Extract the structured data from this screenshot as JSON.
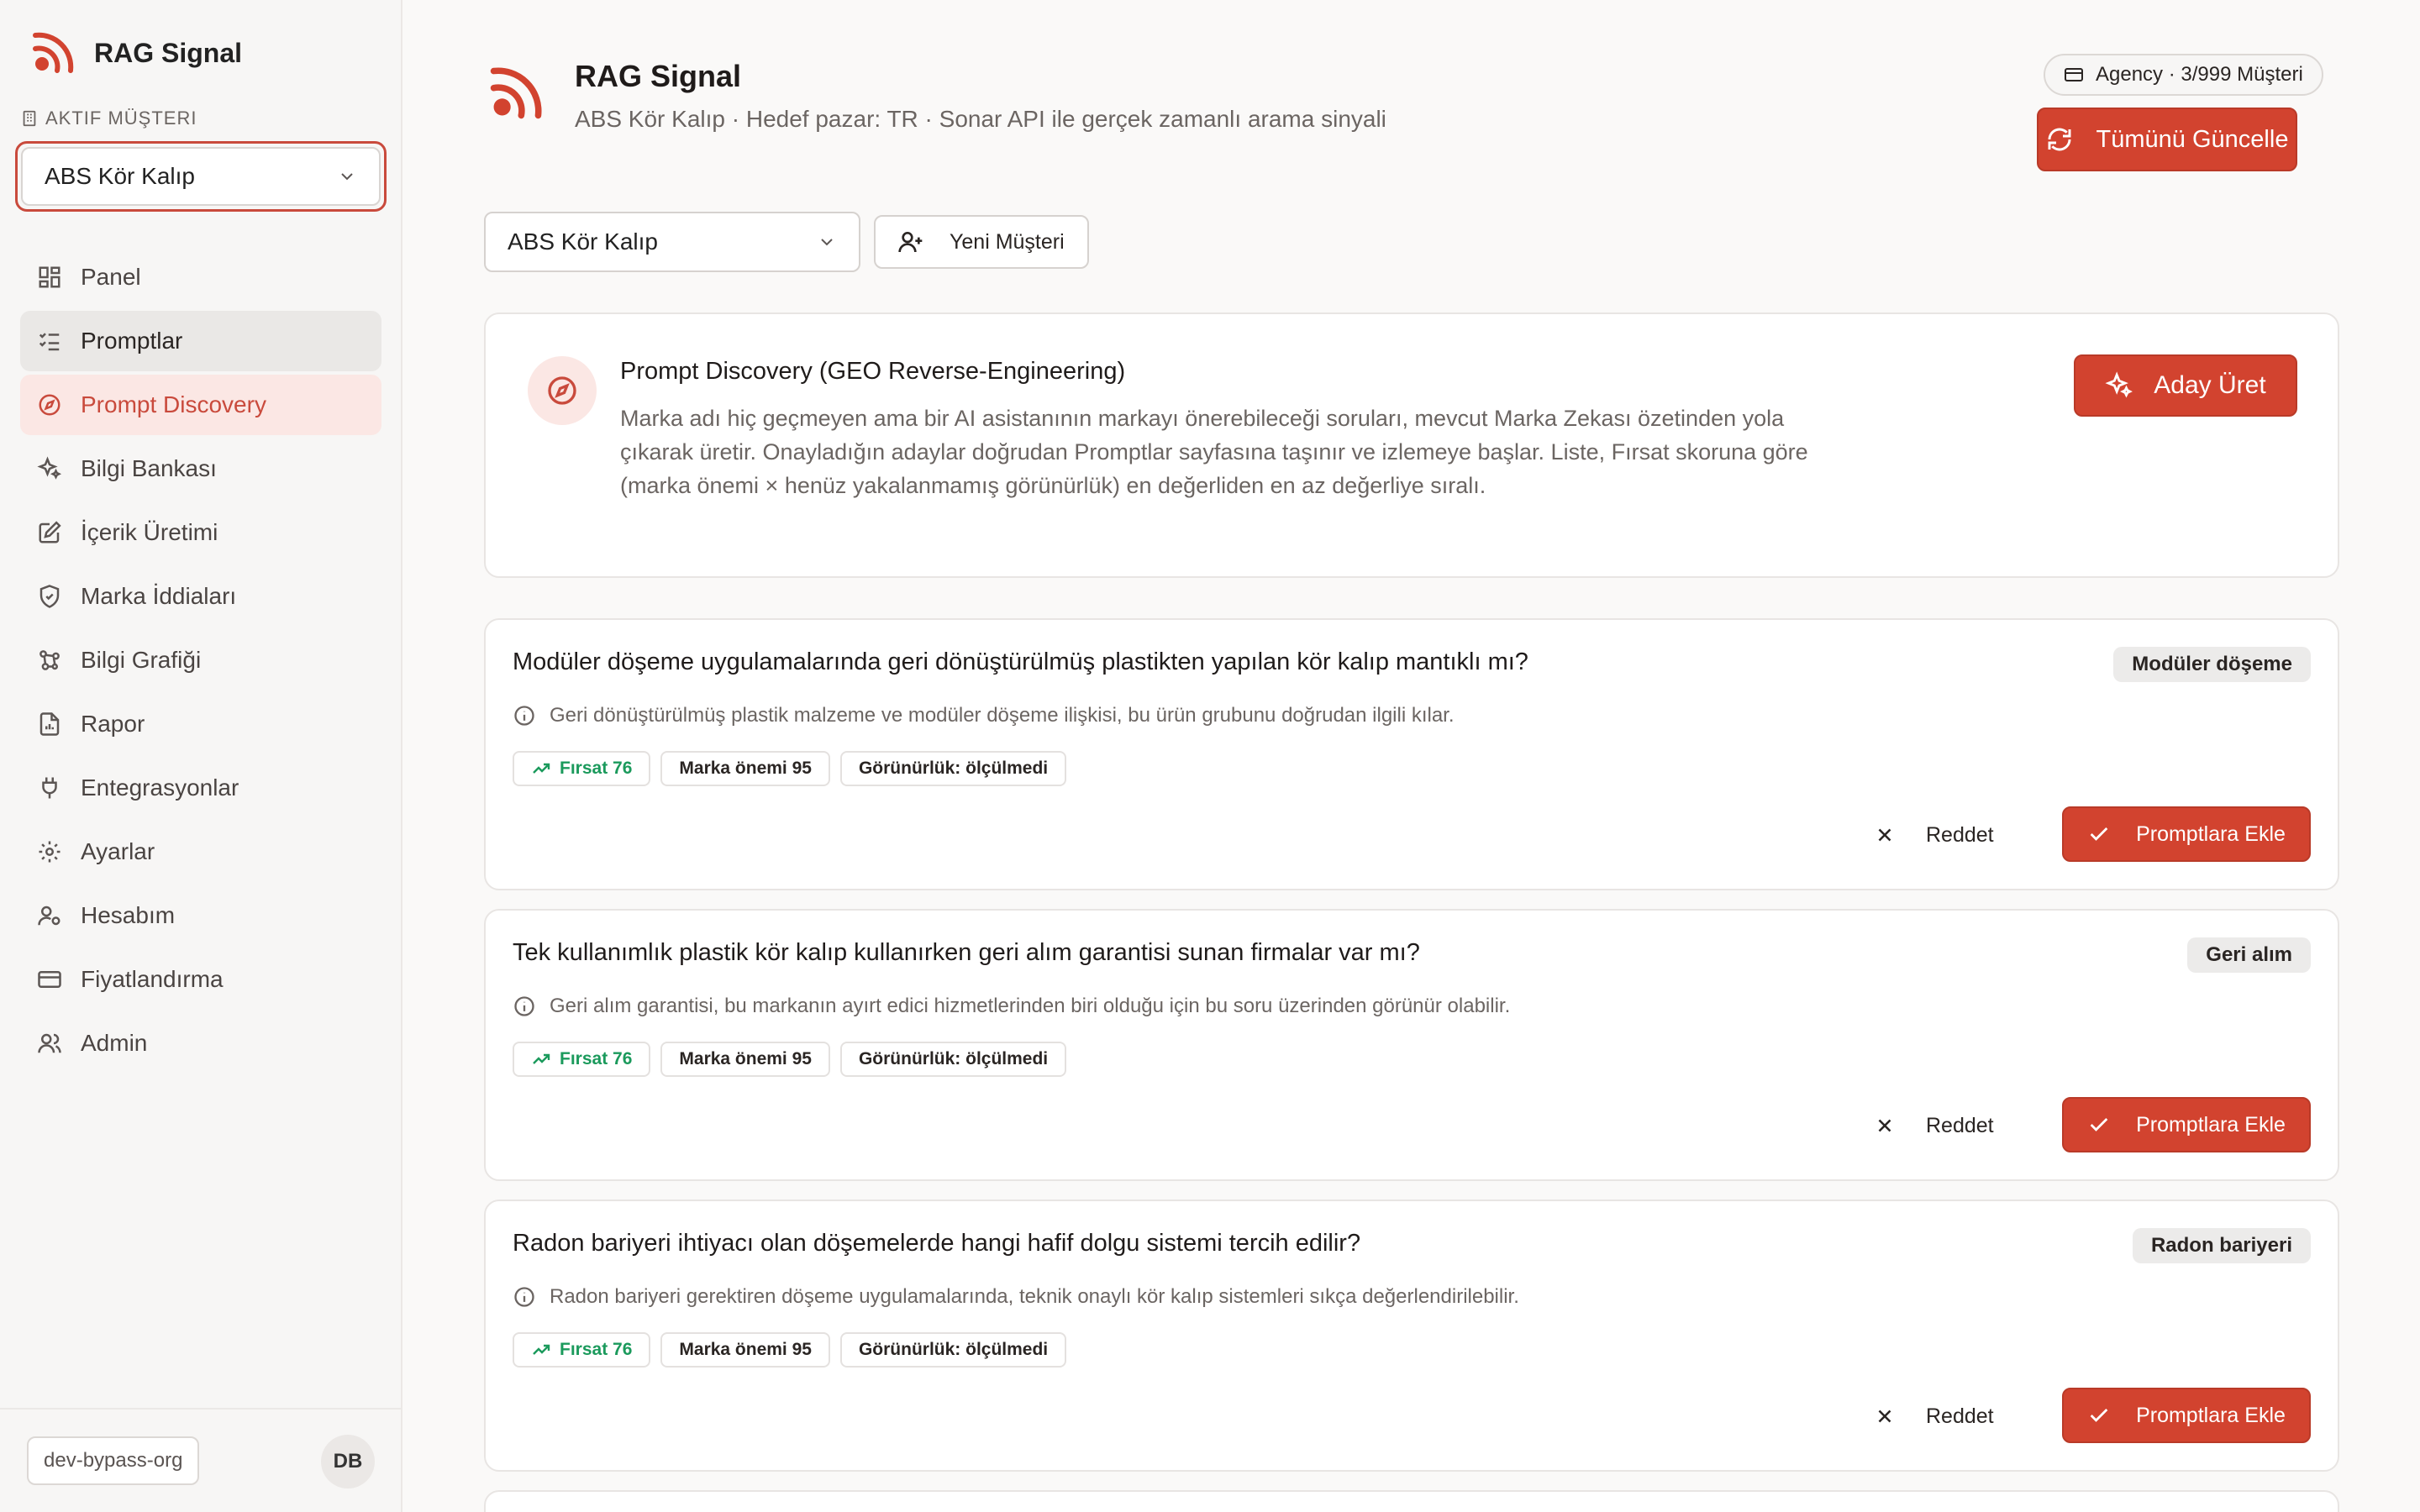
{
  "app": {
    "name": "RAG Signal"
  },
  "sidebar": {
    "active_label": "Aktif Müşteri",
    "selected_client": "ABS Kör Kalıp",
    "items": [
      {
        "label": "Panel",
        "icon": "dashboard-icon"
      },
      {
        "label": "Promptlar",
        "icon": "list-check-icon"
      },
      {
        "label": "Prompt Discovery",
        "icon": "compass-icon"
      },
      {
        "label": "Bilgi Bankası",
        "icon": "sparkles-icon"
      },
      {
        "label": "İçerik Üretimi",
        "icon": "edit-icon"
      },
      {
        "label": "Marka İddiaları",
        "icon": "shield-check-icon"
      },
      {
        "label": "Bilgi Grafiği",
        "icon": "graph-icon"
      },
      {
        "label": "Rapor",
        "icon": "report-icon"
      },
      {
        "label": "Entegrasyonlar",
        "icon": "plug-icon"
      },
      {
        "label": "Ayarlar",
        "icon": "gear-icon"
      },
      {
        "label": "Hesabım",
        "icon": "user-settings-icon"
      },
      {
        "label": "Fiyatlandırma",
        "icon": "credit-card-icon"
      },
      {
        "label": "Admin",
        "icon": "users-icon"
      }
    ],
    "org": "dev-bypass-org",
    "user_initials": "DB"
  },
  "header": {
    "title": "RAG Signal",
    "subtitle": "ABS Kör Kalıp · Hedef pazar: TR · Sonar API ile gerçek zamanlı arama sinyali",
    "plan": "Agency · 3/999 Müşteri",
    "refresh_label": "Tümünü Güncelle"
  },
  "toolbar": {
    "client_value": "ABS Kör Kalıp",
    "new_client_label": "Yeni Müşteri"
  },
  "discovery": {
    "title": "Prompt Discovery (GEO Reverse-Engineering)",
    "description": "Marka adı hiç geçmeyen ama bir AI asistanının markayı önerebileceği soruları, mevcut Marka Zekası özetinden yola çıkarak üretir. Onayladığın adaylar doğrudan Promptlar sayfasına taşınır ve izlemeye başlar. Liste, Fırsat skoruna göre (marka önemi × henüz yakalanmamış görünürlük) en değerliden en az değerliye sıralı.",
    "generate_label": "Aday Üret"
  },
  "candidates": [
    {
      "question": "Modüler döşeme uygulamalarında geri dönüştürülmüş plastikten yapılan kör kalıp mantıklı mı?",
      "tag": "Modüler döşeme",
      "reason": "Geri dönüştürülmüş plastik malzeme ve modüler döşeme ilişkisi, bu ürün grubunu doğrudan ilgili kılar.",
      "opportunity": "Fırsat 76",
      "brand_importance": "Marka önemi 95",
      "visibility": "Görünürlük: ölçülmedi",
      "reject_label": "Reddet",
      "add_label": "Promptlara Ekle"
    },
    {
      "question": "Tek kullanımlık plastik kör kalıp kullanırken geri alım garantisi sunan firmalar var mı?",
      "tag": "Geri alım",
      "reason": "Geri alım garantisi, bu markanın ayırt edici hizmetlerinden biri olduğu için bu soru üzerinden görünür olabilir.",
      "opportunity": "Fırsat 76",
      "brand_importance": "Marka önemi 95",
      "visibility": "Görünürlük: ölçülmedi",
      "reject_label": "Reddet",
      "add_label": "Promptlara Ekle"
    },
    {
      "question": "Radon bariyeri ihtiyacı olan döşemelerde hangi hafif dolgu sistemi tercih edilir?",
      "tag": "Radon bariyeri",
      "reason": "Radon bariyeri gerektiren döşeme uygulamalarında, teknik onaylı kör kalıp sistemleri sıkça değerlendirilebilir.",
      "opportunity": "Fırsat 76",
      "brand_importance": "Marka önemi 95",
      "visibility": "Görünürlük: ölçülmedi",
      "reject_label": "Reddet",
      "add_label": "Promptlara Ekle"
    }
  ],
  "colors": {
    "accent": "#d2432f",
    "accent_soft": "#fbe7e4",
    "success": "#1b9a5c"
  }
}
